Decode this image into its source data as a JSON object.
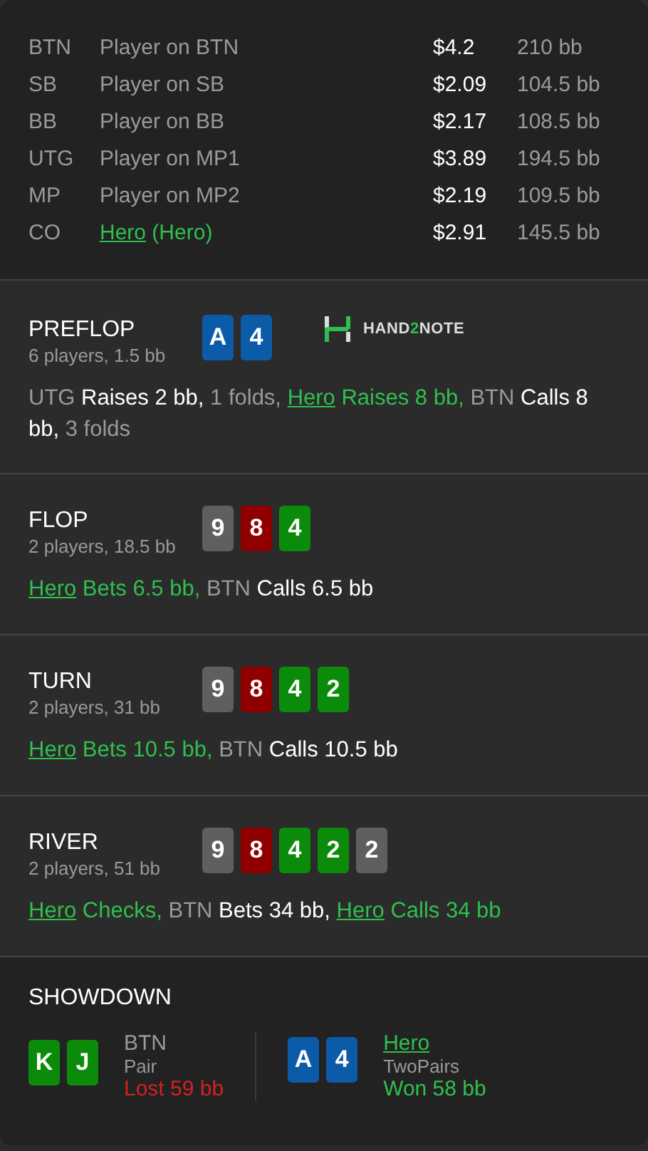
{
  "players": [
    {
      "position": "BTN",
      "name": "Player on BTN",
      "is_hero": false,
      "stack": "$4.2",
      "bb": "210 bb"
    },
    {
      "position": "SB",
      "name": "Player on SB",
      "is_hero": false,
      "stack": "$2.09",
      "bb": "104.5 bb"
    },
    {
      "position": "BB",
      "name": "Player on BB",
      "is_hero": false,
      "stack": "$2.17",
      "bb": "108.5 bb"
    },
    {
      "position": "UTG",
      "name": "Player on MP1",
      "is_hero": false,
      "stack": "$3.89",
      "bb": "194.5 bb"
    },
    {
      "position": "MP",
      "name": "Player on MP2",
      "is_hero": false,
      "stack": "$2.19",
      "bb": "109.5 bb"
    },
    {
      "position": "CO",
      "name": "Hero",
      "note": "(Hero)",
      "is_hero": true,
      "stack": "$2.91",
      "bb": "145.5 bb"
    }
  ],
  "streets": [
    {
      "title": "PREFLOP",
      "info": "6 players, 1.5 bb",
      "logo": {
        "parts": [
          "HAND",
          "2",
          "NOTE"
        ]
      },
      "cards": [
        {
          "rank": "A",
          "color": "#0b5ba8"
        },
        {
          "rank": "4",
          "color": "#0b5ba8"
        }
      ],
      "actions": [
        {
          "kind": "pos",
          "text": "UTG"
        },
        {
          "kind": "act",
          "text": "Raises 2 bb,"
        },
        {
          "kind": "pos",
          "text": "1 folds,"
        },
        {
          "kind": "hero",
          "text": "Hero"
        },
        {
          "kind": "hero_act",
          "text": "Raises 8 bb,"
        },
        {
          "kind": "pos",
          "text": "BTN"
        },
        {
          "kind": "act",
          "text": "Calls 8 bb,"
        },
        {
          "kind": "pos",
          "text": "3 folds"
        }
      ]
    },
    {
      "title": "FLOP",
      "info": "2 players, 18.5 bb",
      "cards": [
        {
          "rank": "9",
          "color": "#5f5f5f"
        },
        {
          "rank": "8",
          "color": "#900000"
        },
        {
          "rank": "4",
          "color": "#0a8c0a"
        }
      ],
      "actions": [
        {
          "kind": "hero",
          "text": "Hero"
        },
        {
          "kind": "hero_act",
          "text": "Bets 6.5 bb,"
        },
        {
          "kind": "pos",
          "text": "BTN"
        },
        {
          "kind": "act",
          "text": "Calls 6.5 bb"
        }
      ]
    },
    {
      "title": "TURN",
      "info": "2 players, 31 bb",
      "cards": [
        {
          "rank": "9",
          "color": "#5f5f5f"
        },
        {
          "rank": "8",
          "color": "#900000"
        },
        {
          "rank": "4",
          "color": "#0a8c0a"
        },
        {
          "rank": "2",
          "color": "#0a8c0a"
        }
      ],
      "actions": [
        {
          "kind": "hero",
          "text": "Hero"
        },
        {
          "kind": "hero_act",
          "text": "Bets 10.5 bb,"
        },
        {
          "kind": "pos",
          "text": "BTN"
        },
        {
          "kind": "act",
          "text": "Calls 10.5 bb"
        }
      ]
    },
    {
      "title": "RIVER",
      "info": "2 players, 51 bb",
      "cards": [
        {
          "rank": "9",
          "color": "#5f5f5f"
        },
        {
          "rank": "8",
          "color": "#900000"
        },
        {
          "rank": "4",
          "color": "#0a8c0a"
        },
        {
          "rank": "2",
          "color": "#0a8c0a"
        },
        {
          "rank": "2",
          "color": "#5f5f5f"
        }
      ],
      "actions": [
        {
          "kind": "hero",
          "text": "Hero"
        },
        {
          "kind": "hero_act",
          "text": "Checks,"
        },
        {
          "kind": "pos",
          "text": "BTN"
        },
        {
          "kind": "act",
          "text": "Bets 34 bb,"
        },
        {
          "kind": "hero",
          "text": "Hero"
        },
        {
          "kind": "hero_act",
          "text": "Calls 34 bb"
        }
      ]
    }
  ],
  "showdown": {
    "title": "SHOWDOWN",
    "hands": [
      {
        "player": "BTN",
        "is_hero": false,
        "hand": "Pair",
        "result": "Lost 59 bb",
        "color": "#d42020",
        "cards": [
          {
            "rank": "K",
            "color": "#0a8c0a"
          },
          {
            "rank": "J",
            "color": "#0a8c0a"
          }
        ]
      },
      {
        "player": "Hero",
        "is_hero": true,
        "hand": "TwoPairs",
        "result": "Won 58 bb",
        "color": "#2fbf4f",
        "cards": [
          {
            "rank": "A",
            "color": "#0b5ba8"
          },
          {
            "rank": "4",
            "color": "#0b5ba8"
          }
        ]
      }
    ]
  }
}
